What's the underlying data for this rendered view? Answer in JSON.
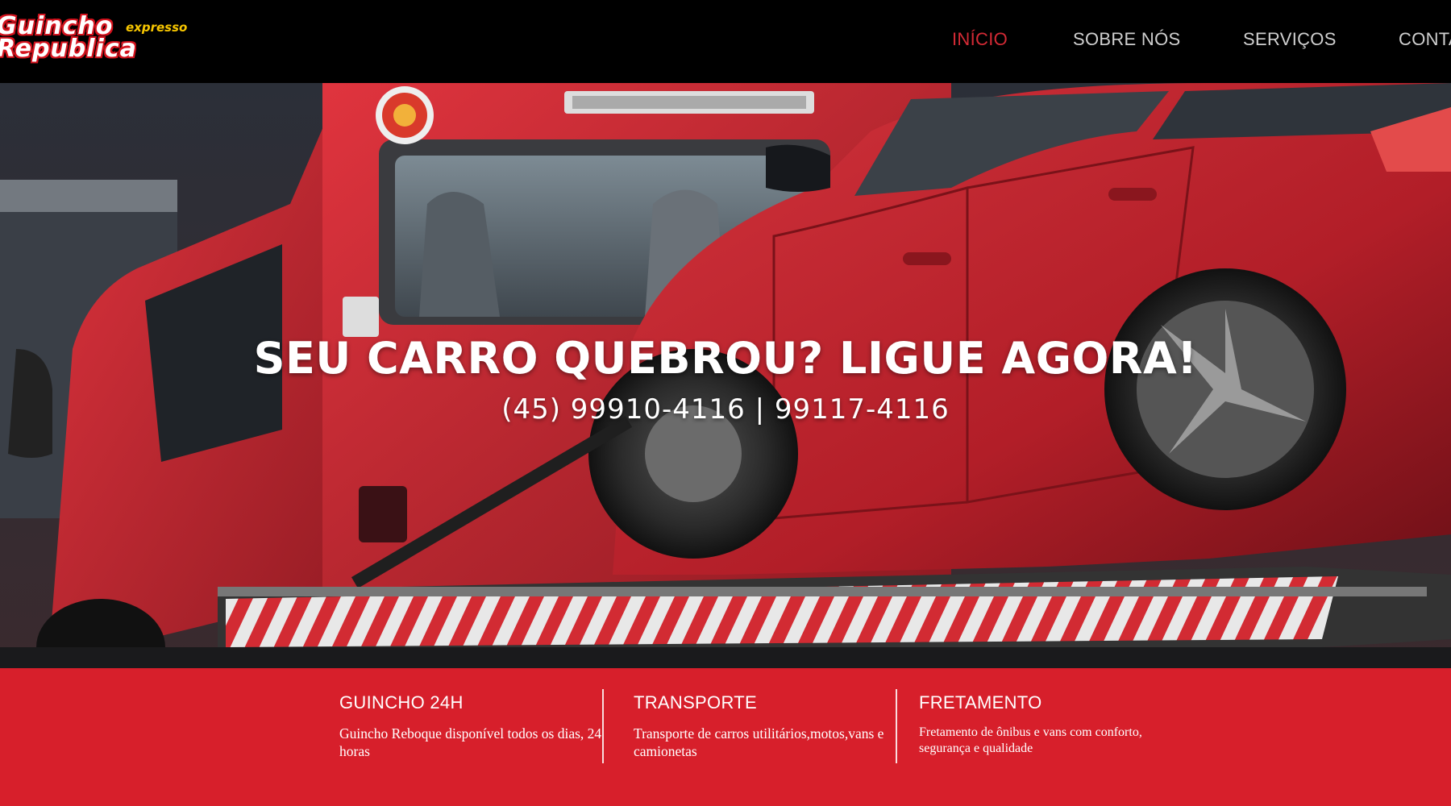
{
  "logo": {
    "line1": "Guincho",
    "line2": "Republica",
    "tagline": "expresso"
  },
  "nav": {
    "items": [
      {
        "label": "INÍCIO",
        "active": true
      },
      {
        "label": "SOBRE NÓS",
        "active": false
      },
      {
        "label": "SERVIÇOS",
        "active": false
      },
      {
        "label": "CONTA",
        "active": false
      }
    ]
  },
  "hero": {
    "title": "SEU CARRO QUEBROU? LIGUE AGORA!",
    "phone": "(45) 99910-4116 | 99117-4116",
    "image": "tow-truck-carrying-red-car"
  },
  "features": [
    {
      "title": "GUINCHO 24H",
      "description": "Guincho Reboque disponível todos os dias, 24 horas"
    },
    {
      "title": "TRANSPORTE",
      "description": "Transporte de carros utilitários,motos,vans e camionetas"
    },
    {
      "title": "FRETAMENTO",
      "description": "Fretamento de ônibus e vans com conforto, segurança e qualidade"
    }
  ],
  "colors": {
    "header_bg": "#000000",
    "nav_text": "#cfcfcf",
    "nav_active": "#d42a35",
    "features_bg": "#d71f2b",
    "logo_accent": "#f7c600"
  }
}
